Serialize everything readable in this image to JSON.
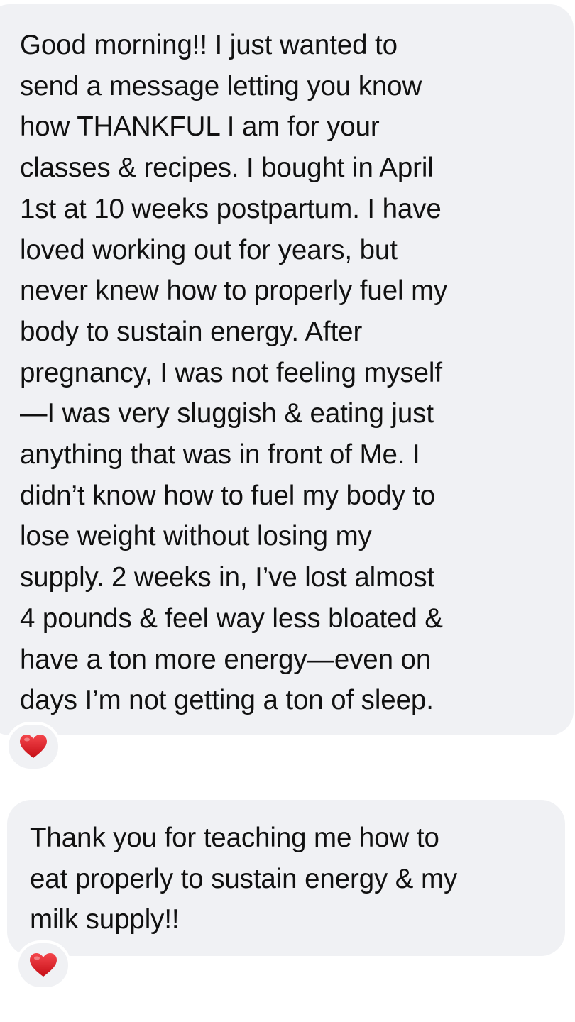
{
  "messages": [
    {
      "lines": [
        "Good morning!! I just wanted to",
        "send a message letting you know",
        "how THANKFUL I am for your",
        "classes & recipes. I bought in April",
        "1st at 10 weeks postpartum. I have",
        "loved working out for years, but",
        "never knew how to properly fuel my",
        "body to sustain energy. After",
        "pregnancy, I was not feeling myself",
        "—I was very sluggish & eating just",
        "anything that was in front of Me. I",
        "didn’t know how to fuel my body to",
        "lose weight without losing my",
        "supply. 2 weeks in, I’ve lost almost",
        "4 pounds & feel way less bloated &",
        "have a ton more energy—even on",
        "days I’m not getting a ton of sleep."
      ],
      "reaction": {
        "icon": "red-heart-icon",
        "color": "#e0151f"
      }
    },
    {
      "lines": [
        "Thank you for teaching me how to",
        "eat properly to sustain energy & my",
        "milk supply!!"
      ],
      "reaction": {
        "icon": "red-heart-icon",
        "color": "#e0151f"
      }
    }
  ]
}
